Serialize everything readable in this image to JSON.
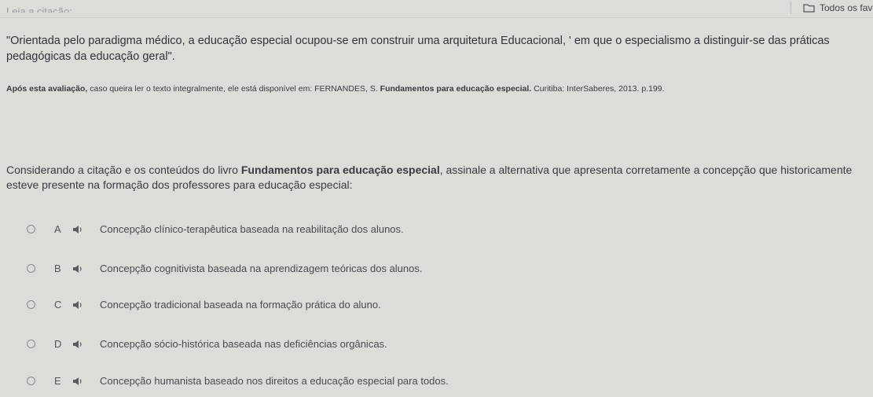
{
  "header": {
    "cut_heading": "Leia a citação:",
    "bookmark_label": "Todos os fav"
  },
  "quote": {
    "text": "\"Orientada pelo paradigma médico, a educação especial ocupou-se em construir uma arquitetura Educacional, ' em que o especialismo a distinguir-se das práticas pedagógicas da educação geral\"."
  },
  "reference": {
    "prefix": "Após esta avaliação,",
    "middle": " caso queira ler o texto integralmente, ele está disponível em: FERNANDES, S. ",
    "book": "Fundamentos para educação especial.",
    "suffix": " Curitiba: InterSaberes, 2013. p.199."
  },
  "question": {
    "before": "Considerando a citação e os conteúdos do livro ",
    "book": "Fundamentos para educação especial",
    "after": ", assinale a alternativa que apresenta corretamente a concepção que historicamente esteve presente na formação dos professores para educação especial:"
  },
  "options": [
    {
      "letter": "A",
      "text": "Concepção clínico-terapêutica baseada na reabilitação dos alunos."
    },
    {
      "letter": "B",
      "text": "Concepção cognitivista baseada na aprendizagem teóricas dos alunos."
    },
    {
      "letter": "C",
      "text": "Concepção tradicional baseada na formação prática do aluno."
    },
    {
      "letter": "D",
      "text": "Concepção sócio-histórica baseada nas deficiências orgânicas."
    },
    {
      "letter": "E",
      "text": "Concepção humanista baseado nos direitos a educação especial para todos."
    }
  ],
  "icons": {
    "folder": "folder-icon",
    "speaker": "speaker-icon",
    "radio": "radio-icon"
  }
}
